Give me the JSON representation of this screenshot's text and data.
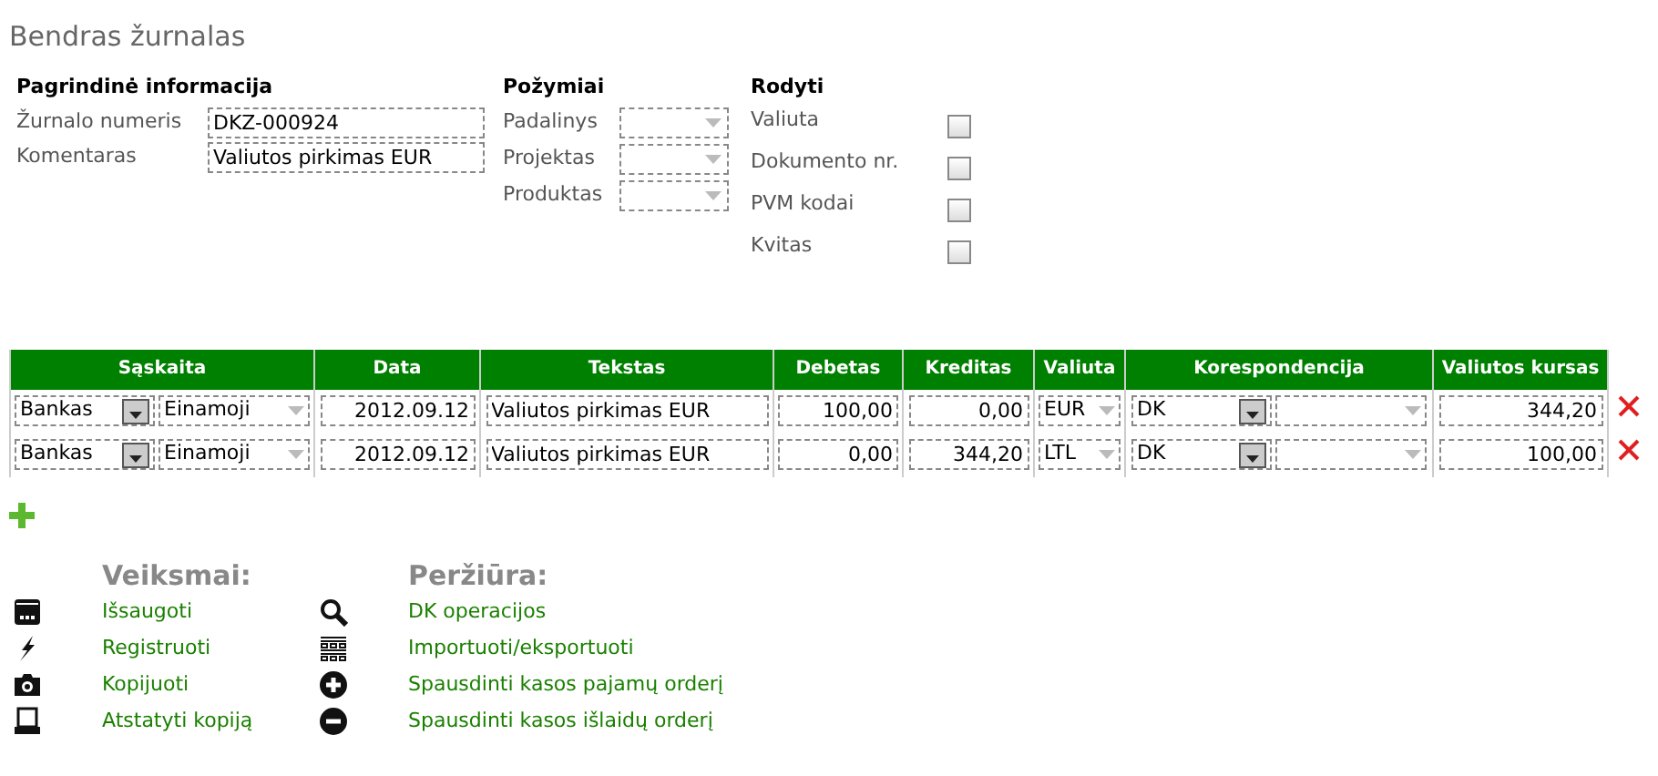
{
  "title": "Bendras žurnalas",
  "main_info": {
    "heading": "Pagrindinė informacija",
    "fields": [
      {
        "label": "Žurnalo numeris",
        "value": "DKZ-000924"
      },
      {
        "label": "Komentaras",
        "value": "Valiutos pirkimas EUR"
      }
    ]
  },
  "attributes": {
    "heading": "Požymiai",
    "fields": [
      {
        "label": "Padalinys"
      },
      {
        "label": "Projektas"
      },
      {
        "label": "Produktas"
      }
    ]
  },
  "show": {
    "heading": "Rodyti",
    "options": [
      {
        "label": "Valiuta",
        "checked": false
      },
      {
        "label": "Dokumento nr.",
        "checked": false
      },
      {
        "label": "PVM kodai",
        "checked": false
      },
      {
        "label": "Kvitas",
        "checked": false
      }
    ]
  },
  "table": {
    "columns": [
      "Sąskaita",
      "Data",
      "Tekstas",
      "Debetas",
      "Kreditas",
      "Valiuta",
      "Korespondencija",
      "Valiutos kursas"
    ],
    "rows": [
      {
        "account": "Bankas",
        "subaccount": "Einamoji",
        "date": "2012.09.12",
        "text": "Valiutos pirkimas EUR",
        "debit": "100,00",
        "credit": "0,00",
        "currency": "EUR",
        "correspondence": "DK",
        "rate": "344,20"
      },
      {
        "account": "Bankas",
        "subaccount": "Einamoji",
        "date": "2012.09.12",
        "text": "Valiutos pirkimas EUR",
        "debit": "0,00",
        "credit": "344,20",
        "currency": "LTL",
        "correspondence": "DK",
        "rate": "100,00"
      }
    ]
  },
  "actions": {
    "heading": "Veiksmai:",
    "items": [
      {
        "kind": "save",
        "label": "Išsaugoti"
      },
      {
        "kind": "register",
        "label": "Registruoti"
      },
      {
        "kind": "copy",
        "label": "Kopijuoti"
      },
      {
        "kind": "restore",
        "label": "Atstatyti kopiją"
      }
    ]
  },
  "views": {
    "heading": "Peržiūra:",
    "items": [
      {
        "kind": "search",
        "label": "DK operacijos"
      },
      {
        "kind": "grid",
        "label": "Importuoti/eksportuoti"
      },
      {
        "kind": "plus",
        "label": "Spausdinti kasos pajamų orderį"
      },
      {
        "kind": "minus",
        "label": "Spausdinti kasos išlaidų orderį"
      }
    ]
  }
}
